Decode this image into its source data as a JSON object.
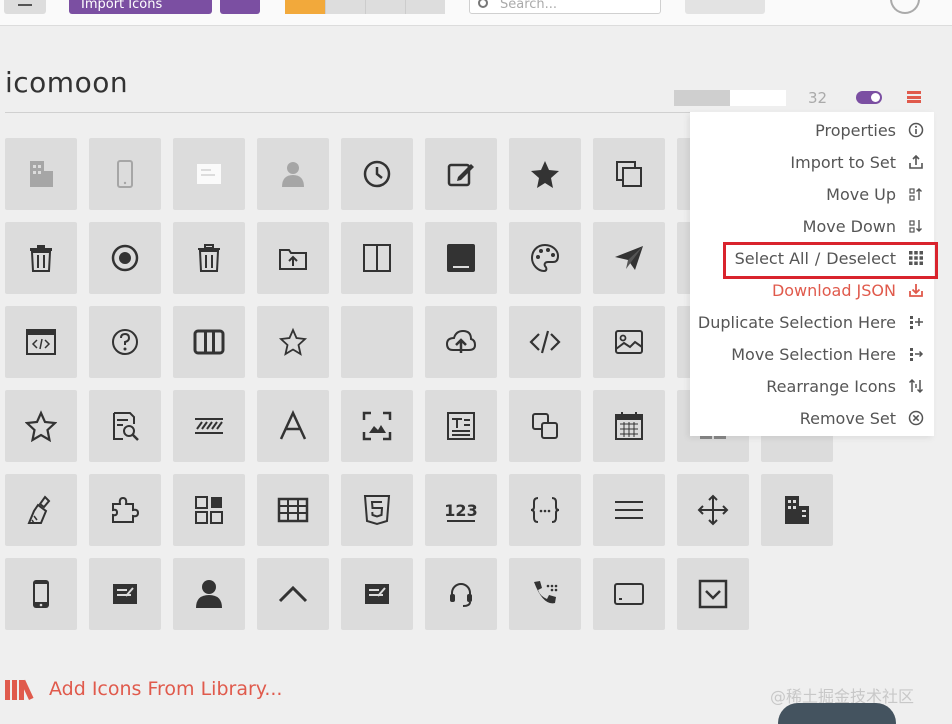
{
  "toolbar": {
    "import_label": "Import Icons",
    "search_placeholder": "Search..."
  },
  "set": {
    "title": "icomoon",
    "count": "32"
  },
  "menu": {
    "properties": "Properties",
    "import_to_set": "Import to Set",
    "move_up": "Move Up",
    "move_down": "Move Down",
    "select_all": "Select All",
    "sep": "/",
    "deselect": "Deselect",
    "download_json": "Download JSON",
    "duplicate": "Duplicate Selection Here",
    "move_selection": "Move Selection Here",
    "rearrange": "Rearrange Icons",
    "remove": "Remove Set"
  },
  "footer": {
    "add_library": "Add Icons From Library...",
    "watermark": "@稀土掘金技术社区"
  },
  "colors": {
    "accent_purple": "#7b4fa2",
    "accent_red": "#e05a4c",
    "highlight": "#d9232d"
  },
  "icons": [
    "office-icon",
    "mobile-icon",
    "newspaper-icon",
    "user-icon",
    "clock-icon",
    "edit-icon",
    "star-filled-icon",
    "copy-icon",
    "sliders-icon",
    "checkbox-icon",
    "trash-icon",
    "radio-icon",
    "trash-icon-2",
    "folder-upload-icon",
    "columns-icon",
    "square-filled-icon",
    "palette-icon",
    "paper-plane-icon",
    "refresh-icon",
    "browser-code-icon",
    "help-icon",
    "columns-3-icon",
    "star-outline-icon",
    "blank-icon",
    "cloud-upload-icon",
    "code-icon",
    "image-icon",
    "browser-icon",
    "star-outline-icon-2",
    "search-doc-icon",
    "stripes-icon",
    "font-icon",
    "scan-image-icon",
    "text-box-icon",
    "copy-outline-icon",
    "calendar-icon",
    "grid-icon",
    "brush-icon",
    "puzzle-icon",
    "apps-icon",
    "table-icon",
    "html5-icon",
    "numbers-icon",
    "braces-icon",
    "menu-lines-icon",
    "move-icon",
    "office-icon-2",
    "mobile-icon-2",
    "newspaper-icon-2",
    "user-icon-2",
    "chevron-up-icon",
    "newspaper-icon-3",
    "headset-icon",
    "phone-icon",
    "tablet-icon",
    "checkbox-icon-2"
  ]
}
